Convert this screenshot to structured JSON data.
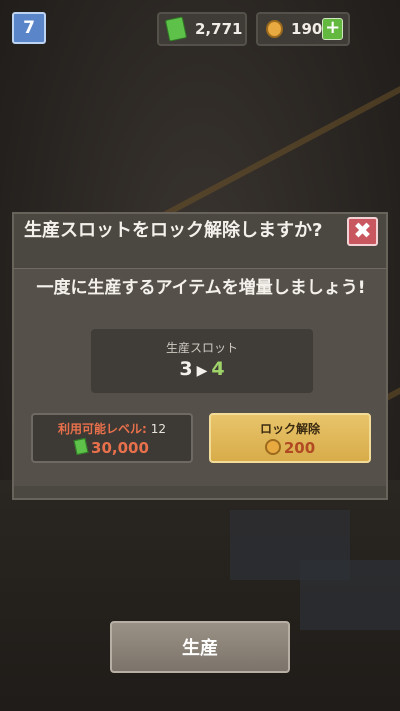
{
  "hud": {
    "level": "7",
    "cash": "2,771",
    "coins": "190",
    "cash_icon": "cash-icon",
    "coin_icon": "coin-icon"
  },
  "modal": {
    "title": "生産スロットをロック解除しますか?",
    "message": "一度に生産するアイテムを増量しましょう!",
    "slot_label": "生産スロット",
    "slot_current": "3",
    "slot_next": "4",
    "requirement_label": "利用可能レベル:",
    "requirement_level": "12",
    "cash_price": "30,000",
    "unlock_label": "ロック解除",
    "coin_price": "200"
  },
  "produce_button": {
    "label": "生産"
  },
  "colors": {
    "accent_gold": "#e8c46a",
    "price_red": "#e8704b",
    "close_red": "#c9575f",
    "level_blue": "#5a86c9",
    "plus_green": "#63b83f"
  }
}
